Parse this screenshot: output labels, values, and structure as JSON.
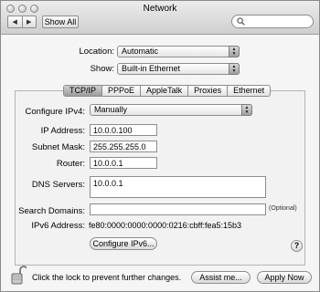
{
  "window": {
    "title": "Network"
  },
  "toolbar": {
    "back_icon": "back-arrow",
    "forward_icon": "forward-arrow",
    "show_all_label": "Show All",
    "search_placeholder": ""
  },
  "location": {
    "label": "Location:",
    "value": "Automatic"
  },
  "show": {
    "label": "Show:",
    "value": "Built-in Ethernet"
  },
  "tabs": [
    {
      "label": "TCP/IP",
      "selected": true
    },
    {
      "label": "PPPoE",
      "selected": false
    },
    {
      "label": "AppleTalk",
      "selected": false
    },
    {
      "label": "Proxies",
      "selected": false
    },
    {
      "label": "Ethernet",
      "selected": false
    }
  ],
  "tcpip": {
    "configure_label": "Configure IPv4:",
    "configure_value": "Manually",
    "ip_label": "IP Address:",
    "ip_value": "10.0.0.100",
    "subnet_label": "Subnet Mask:",
    "subnet_value": "255.255.255.0",
    "router_label": "Router:",
    "router_value": "10.0.0.1",
    "dns_label": "DNS Servers:",
    "dns_value": "10.0.0.1",
    "search_domains_label": "Search Domains:",
    "search_domains_value": "",
    "optional_text": "(Optional)",
    "ipv6_label": "IPv6 Address:",
    "ipv6_value": "fe80:0000:0000:0000:0216:cbff:fea5:15b3",
    "configure_ipv6_button": "Configure IPv6...",
    "help_label": "?"
  },
  "footer": {
    "lock_text": "Click the lock to prevent further changes.",
    "assist_button": "Assist me...",
    "apply_button": "Apply Now"
  }
}
